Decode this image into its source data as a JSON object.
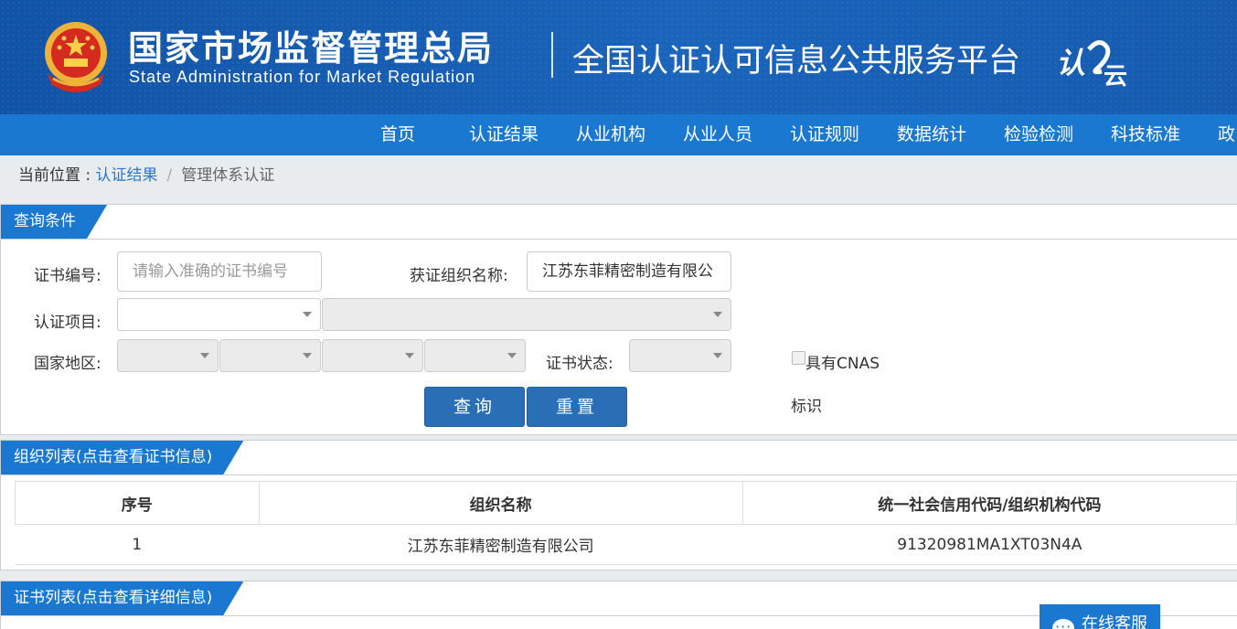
{
  "header": {
    "agency_cn": "国家市场监督管理总局",
    "agency_en": "State Administration  for  Market Regulation",
    "platform_title": "全国认证认可信息公共服务平台",
    "logo_text": "认云",
    "emblem_icon": "national-emblem-icon",
    "colors": {
      "header_bg": "#1a64bb",
      "nav_bg": "#1b78d0"
    }
  },
  "nav": {
    "items": [
      "首页",
      "认证结果",
      "从业机构",
      "从业人员",
      "认证规则",
      "数据统计",
      "检验检测",
      "科技标准",
      "政"
    ]
  },
  "breadcrumb": {
    "label": "当前位置 : ",
    "link": "认证结果",
    "separator": "/",
    "current": "管理体系认证"
  },
  "query_panel": {
    "title": "查询条件",
    "cert_no_label": "证书编号:",
    "cert_no_placeholder": "请输入准确的证书编号",
    "org_name_label": "获证组织名称:",
    "org_name_value": "江苏东菲精密制造有限公",
    "cert_project_label": "认证项目:",
    "region_label": "国家地区:",
    "cert_status_label": "证书状态:",
    "cnas_label": "具有CNAS",
    "cnas_label2": "标识",
    "search_button": "查询",
    "reset_button": "重置"
  },
  "org_panel": {
    "title": "组织列表(点击查看证书信息)",
    "columns": [
      "序号",
      "组织名称",
      "统一社会信用代码/组织机构代码"
    ],
    "rows": [
      [
        "1",
        "江苏东菲精密制造有限公司",
        "91320981MA1XT03N4A"
      ]
    ]
  },
  "cert_panel": {
    "title": "证书列表(点击查看详细信息)"
  },
  "chat_widget": {
    "label": "在线客服",
    "icon": "chat-bubble-icon"
  }
}
